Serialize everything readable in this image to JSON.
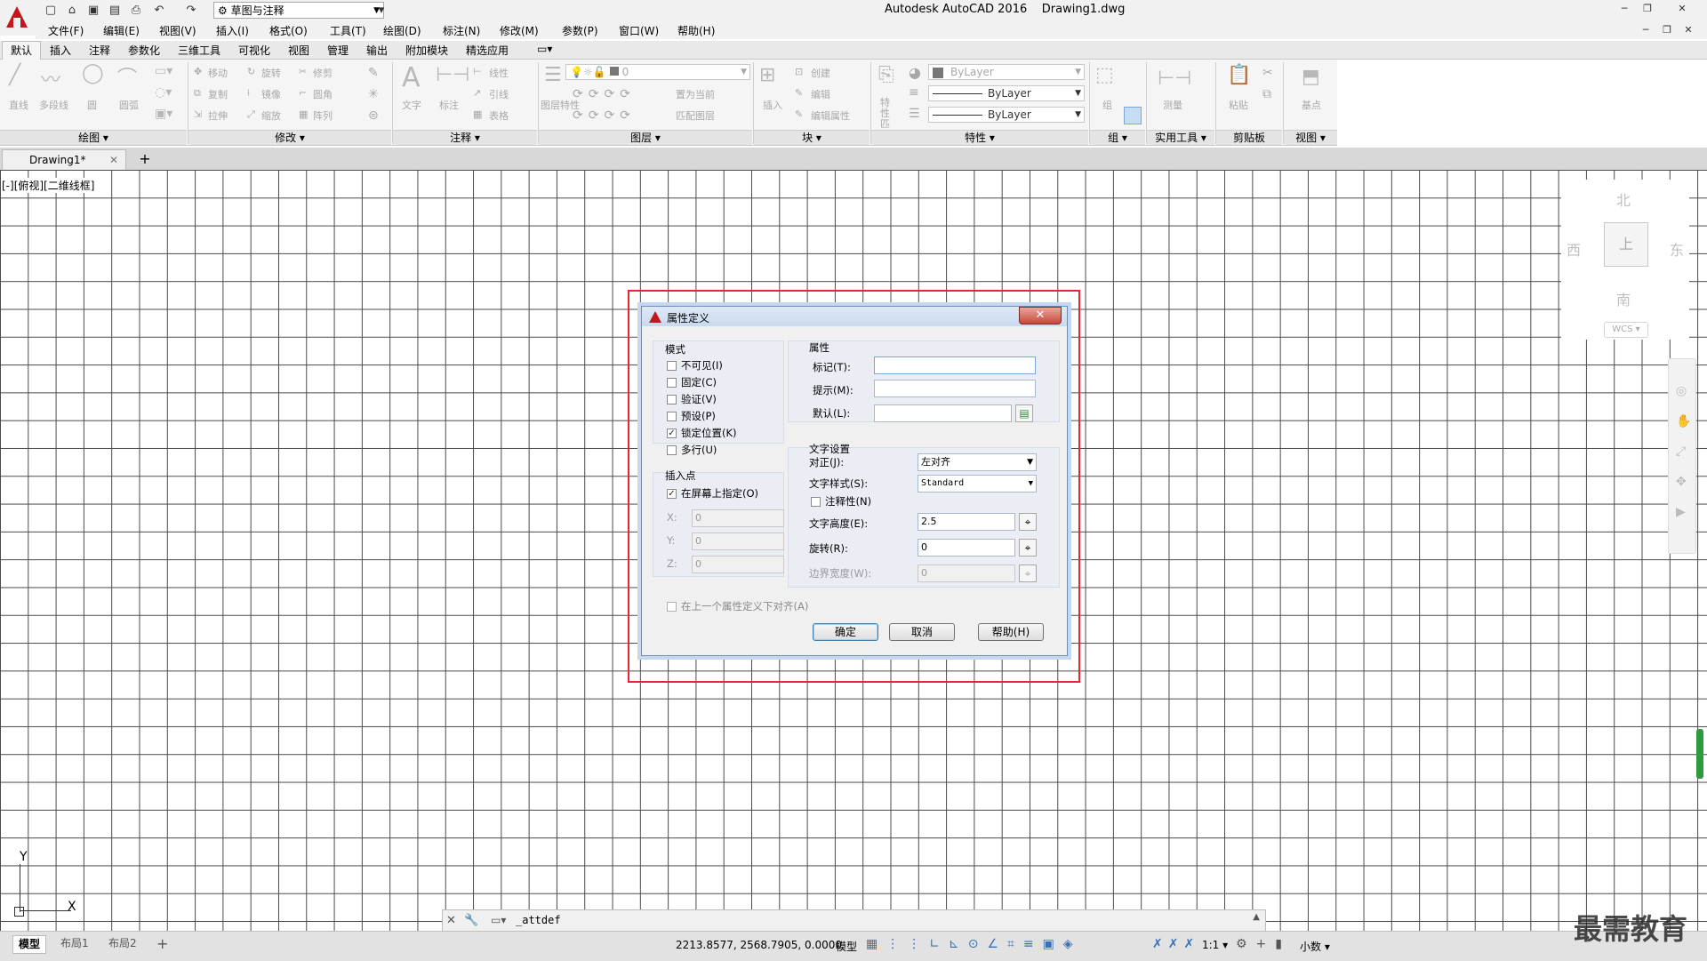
{
  "app": {
    "title": "Autodesk AutoCAD 2016",
    "filename": "Drawing1.dwg",
    "workspace": "草图与注释"
  },
  "menubar": [
    "文件(F)",
    "编辑(E)",
    "视图(V)",
    "插入(I)",
    "格式(O)",
    "工具(T)",
    "绘图(D)",
    "标注(N)",
    "修改(M)",
    "参数(P)",
    "窗口(W)",
    "帮助(H)"
  ],
  "ribbon_tabs": [
    "默认",
    "插入",
    "注释",
    "参数化",
    "三维工具",
    "可视化",
    "视图",
    "管理",
    "输出",
    "附加模块",
    "精选应用"
  ],
  "ribbon": {
    "draw": {
      "items": [
        "直线",
        "多段线",
        "圆",
        "圆弧"
      ],
      "panel": "绘图"
    },
    "modify": {
      "items": [
        "移动",
        "旋转",
        "修剪",
        "复制",
        "镜像",
        "圆角",
        "拉伸",
        "缩放",
        "阵列"
      ],
      "panel": "修改"
    },
    "annotation": {
      "items": [
        "文字",
        "标注",
        "线性",
        "引线",
        "表格"
      ],
      "panel": "注释"
    },
    "layers": {
      "items": [
        "图层特性",
        "置为当前",
        "匹配图层"
      ],
      "current_layer": "0",
      "panel": "图层"
    },
    "block": {
      "items": [
        "插入",
        "创建",
        "编辑",
        "编辑属性"
      ],
      "panel": "块"
    },
    "properties": {
      "items": [
        "特性匹配"
      ],
      "color": "ByLayer",
      "linetype": "ByLayer",
      "lineweight": "ByLayer",
      "panel": "特性"
    },
    "group": {
      "items": [
        "组"
      ],
      "panel": "组"
    },
    "utilities": {
      "items": [
        "测量"
      ],
      "panel": "实用工具"
    },
    "clipboard": {
      "items": [
        "粘贴"
      ],
      "panel": "剪贴板"
    },
    "view": {
      "items": [
        "基点"
      ],
      "panel": "视图"
    }
  },
  "file_tab": "Drawing1*",
  "view_label": "[-][俯视][二维线框]",
  "viewcube": {
    "north": "北",
    "south": "南",
    "east": "东",
    "west": "西",
    "top": "上",
    "wcs": "WCS"
  },
  "ucs": {
    "x": "X",
    "y": "Y"
  },
  "command_line": "_attdef",
  "layout_tabs": [
    "模型",
    "布局1",
    "布局2"
  ],
  "status": {
    "coords": "2213.8577, 2568.7905, 0.0000",
    "space": "模型",
    "scale": "1:1",
    "units": "小数"
  },
  "watermark": "最需教育",
  "dialog": {
    "title": "属性定义",
    "mode": {
      "title": "模式",
      "options": [
        {
          "label": "不可见(I)",
          "checked": false
        },
        {
          "label": "固定(C)",
          "checked": false
        },
        {
          "label": "验证(V)",
          "checked": false
        },
        {
          "label": "预设(P)",
          "checked": false
        },
        {
          "label": "锁定位置(K)",
          "checked": true
        },
        {
          "label": "多行(U)",
          "checked": false
        }
      ]
    },
    "insertion": {
      "title": "插入点",
      "on_screen": {
        "label": "在屏幕上指定(O)",
        "checked": true
      },
      "x_label": "X:",
      "x": "0",
      "y_label": "Y:",
      "y": "0",
      "z_label": "Z:",
      "z": "0"
    },
    "attribute": {
      "title": "属性",
      "tag_label": "标记(T):",
      "tag": "",
      "prompt_label": "提示(M):",
      "prompt": "",
      "default_label": "默认(L):",
      "default": ""
    },
    "text_settings": {
      "title": "文字设置",
      "justify_label": "对正(J):",
      "justify": "左对齐",
      "style_label": "文字样式(S):",
      "style": "Standard",
      "annotative_label": "注释性(N)",
      "annotative": false,
      "height_label": "文字高度(E):",
      "height": "2.5",
      "rotation_label": "旋转(R):",
      "rotation": "0",
      "boundary_label": "边界宽度(W):",
      "boundary": "0"
    },
    "align_below": {
      "label": "在上一个属性定义下对齐(A)",
      "checked": false
    },
    "buttons": {
      "ok": "确定",
      "cancel": "取消",
      "help": "帮助(H)"
    }
  },
  "colors": {
    "highlight_box": "#e8262f",
    "app_red": "#c4161c",
    "grid": "#4a4a4a"
  }
}
